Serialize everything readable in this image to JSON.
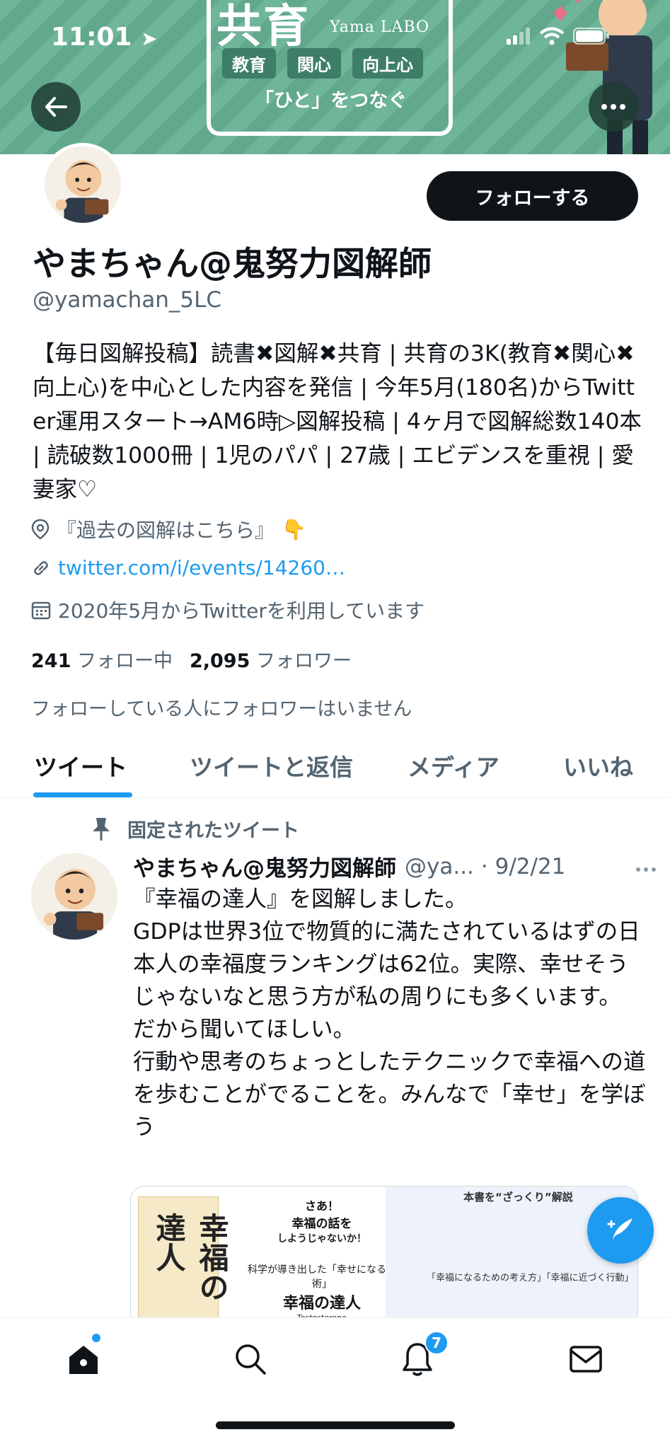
{
  "status_bar": {
    "time": "11:01"
  },
  "banner": {
    "title": "共育",
    "subtitle": "Yama LABO",
    "tags": [
      "教育",
      "関心",
      "向上心"
    ],
    "tagline": "「ひと」をつなぐ"
  },
  "profile": {
    "follow_label": "フォローする",
    "display_name": "やまちゃん@鬼努力図解師",
    "handle": "@yamachan_5LC",
    "bio": "【毎日図解投稿】読書✖図解✖共育 | 共育の3K(教育✖関心✖向上心)を中心とした内容を発信 | 今年5月(180名)からTwitter運用スタート→AM6時▷図解投稿 | 4ヶ月で図解総数140本 | 読破数1000冊 | 1児のパパ | 27歳 | エビデンスを重視 | 愛妻家♡",
    "location": "『過去の図解はこちら』",
    "location_emoji": "👇",
    "link": "twitter.com/i/events/14260…",
    "joined": "2020年5月からTwitterを利用しています",
    "following_count": "241",
    "following_label": "フォロー中",
    "followers_count": "2,095",
    "followers_label": "フォロワー",
    "no_followers_note": "フォローしている人にフォロワーはいません"
  },
  "tabs": [
    {
      "label": "ツイート",
      "active": true
    },
    {
      "label": "ツイートと返信",
      "active": false
    },
    {
      "label": "メディア",
      "active": false
    },
    {
      "label": "いいね",
      "active": false
    }
  ],
  "tweet": {
    "pinned_label": "固定されたツイート",
    "name": "やまちゃん@鬼努力図解師",
    "handle": "@ya...",
    "date": "· 9/2/21",
    "body": "『幸福の達人』を図解しました。\nGDPは世界3位で物質的に満たされているはずの日本人の幸福度ランキングは62位。実際、幸せそうじゃないなと思う方が私の周りにも多くいます。\nだから聞いてほしい。\n行動や思考のちょっとしたテクニックで幸福への道を歩むことがでることを。みんなで「幸せ」を学ぼう",
    "media": {
      "book_title": "幸福の達人",
      "center_lead": "さあ！",
      "center_line1": "幸福の話を",
      "center_line2": "しようじゃないか！",
      "center_caption": "科学が導き出した「幸せになる技術」",
      "center_title": "幸福の達人",
      "center_author": "Testosterone",
      "right_title": "本書を“ざっくり”解説",
      "right_sub": "「幸福になるための考え方」「幸福に近づく行動」"
    }
  },
  "bottom_nav": {
    "notification_count": "7"
  },
  "colors": {
    "accent": "#1d9bf0",
    "text_primary": "#0f1419",
    "text_secondary": "#536471",
    "banner_green": "#6fb59a"
  },
  "icons": {
    "back": "arrow-left-icon",
    "more": "more-horizontal-icon",
    "location": "location-pin-icon",
    "link": "link-icon",
    "calendar": "calendar-icon",
    "pin": "pin-icon",
    "compose": "compose-feather-icon",
    "home": "home-icon",
    "search": "search-icon",
    "notifications": "bell-icon",
    "messages": "mail-icon"
  }
}
